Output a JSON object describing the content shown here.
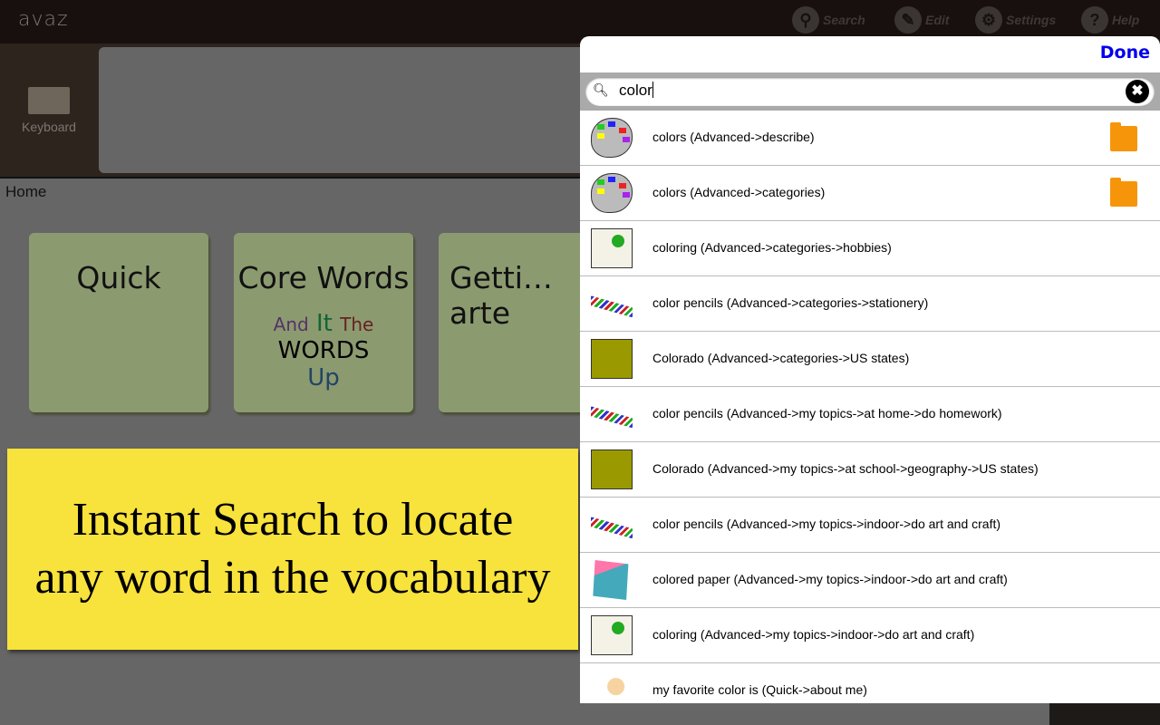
{
  "app": {
    "logo": "avaz"
  },
  "toolbar": {
    "search": "Search",
    "edit": "Edit",
    "settings": "Settings",
    "help": "Help"
  },
  "sidebar": {
    "keyboard": "Keyboard"
  },
  "breadcrumb": "Home",
  "tiles": [
    "Quick",
    "Core Words",
    "Getti…arte"
  ],
  "core_words_art": [
    "And",
    "It",
    "The",
    "WORDS",
    "Up"
  ],
  "banner": {
    "line1": "Instant Search to locate",
    "line2": "any word in the vocabulary"
  },
  "search": {
    "done": "Done",
    "query": "color",
    "results": [
      {
        "label": "colors (Advanced->describe)",
        "icon": "palette",
        "folder": true
      },
      {
        "label": "colors (Advanced->categories)",
        "icon": "palette",
        "folder": true
      },
      {
        "label": "coloring (Advanced->categories->hobbies)",
        "icon": "coloring-book",
        "folder": false
      },
      {
        "label": "color pencils (Advanced->categories->stationery)",
        "icon": "pencils",
        "folder": false
      },
      {
        "label": "Colorado (Advanced->categories->US states)",
        "icon": "colorado",
        "folder": false
      },
      {
        "label": "color pencils (Advanced->my topics->at home->do homework)",
        "icon": "pencils",
        "folder": false
      },
      {
        "label": "Colorado (Advanced->my topics->at school->geography->US states)",
        "icon": "colorado",
        "folder": false
      },
      {
        "label": "color pencils (Advanced->my topics->indoor->do art and craft)",
        "icon": "pencils",
        "folder": false
      },
      {
        "label": "colored paper (Advanced->my topics->indoor->do art and craft)",
        "icon": "colored-paper",
        "folder": false
      },
      {
        "label": "coloring (Advanced->my topics->indoor->do art and craft)",
        "icon": "coloring-book",
        "folder": false
      },
      {
        "label": "my favorite color is (Quick->about me)",
        "icon": "boy",
        "folder": false
      }
    ]
  },
  "colors": {
    "accent": "#0000ee",
    "banner": "#f8e23c",
    "folder": "#f7950a"
  }
}
